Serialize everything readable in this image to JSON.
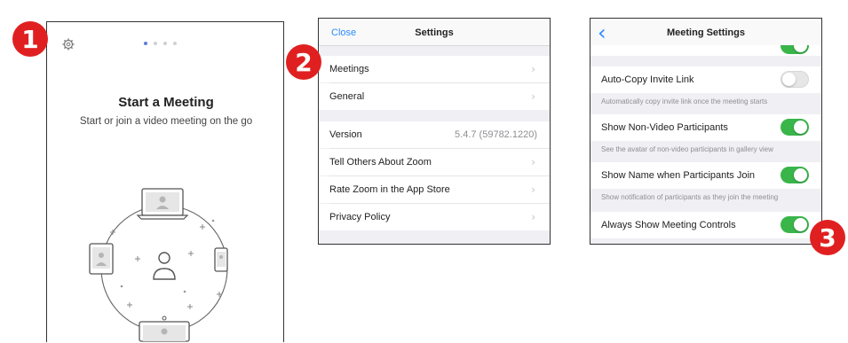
{
  "badges": [
    "1",
    "2",
    "3"
  ],
  "panel1": {
    "title": "Start a Meeting",
    "subtitle": "Start or join a video meeting on the go",
    "page_dots": 4,
    "active_dot": 1
  },
  "panel2": {
    "header": {
      "close": "Close",
      "title": "Settings"
    },
    "group1": [
      {
        "label": "Meetings"
      },
      {
        "label": "General"
      }
    ],
    "group2": {
      "version_label": "Version",
      "version_value": "5.4.7 (59782.1220)",
      "items": [
        {
          "label": "Tell Others About Zoom"
        },
        {
          "label": "Rate Zoom in the App Store"
        },
        {
          "label": "Privacy Policy"
        }
      ]
    }
  },
  "panel3": {
    "header": {
      "back": "‹",
      "title": "Meeting Settings"
    },
    "settings": [
      {
        "label": "Auto-Copy Invite Link",
        "on": false,
        "note": "Automatically copy invite link once the meeting starts"
      },
      {
        "label": "Show Non-Video Participants",
        "on": true,
        "note": "See the avatar of non-video participants in gallery view"
      },
      {
        "label": "Show Name when Participants Join",
        "on": true,
        "note": "Show notification of participants as they join the meeting"
      },
      {
        "label": "Always Show Meeting Controls",
        "on": true,
        "note": ""
      }
    ]
  },
  "colors": {
    "badge": "#e02020",
    "toggle_on": "#39b54a",
    "link": "#2d8cff"
  }
}
